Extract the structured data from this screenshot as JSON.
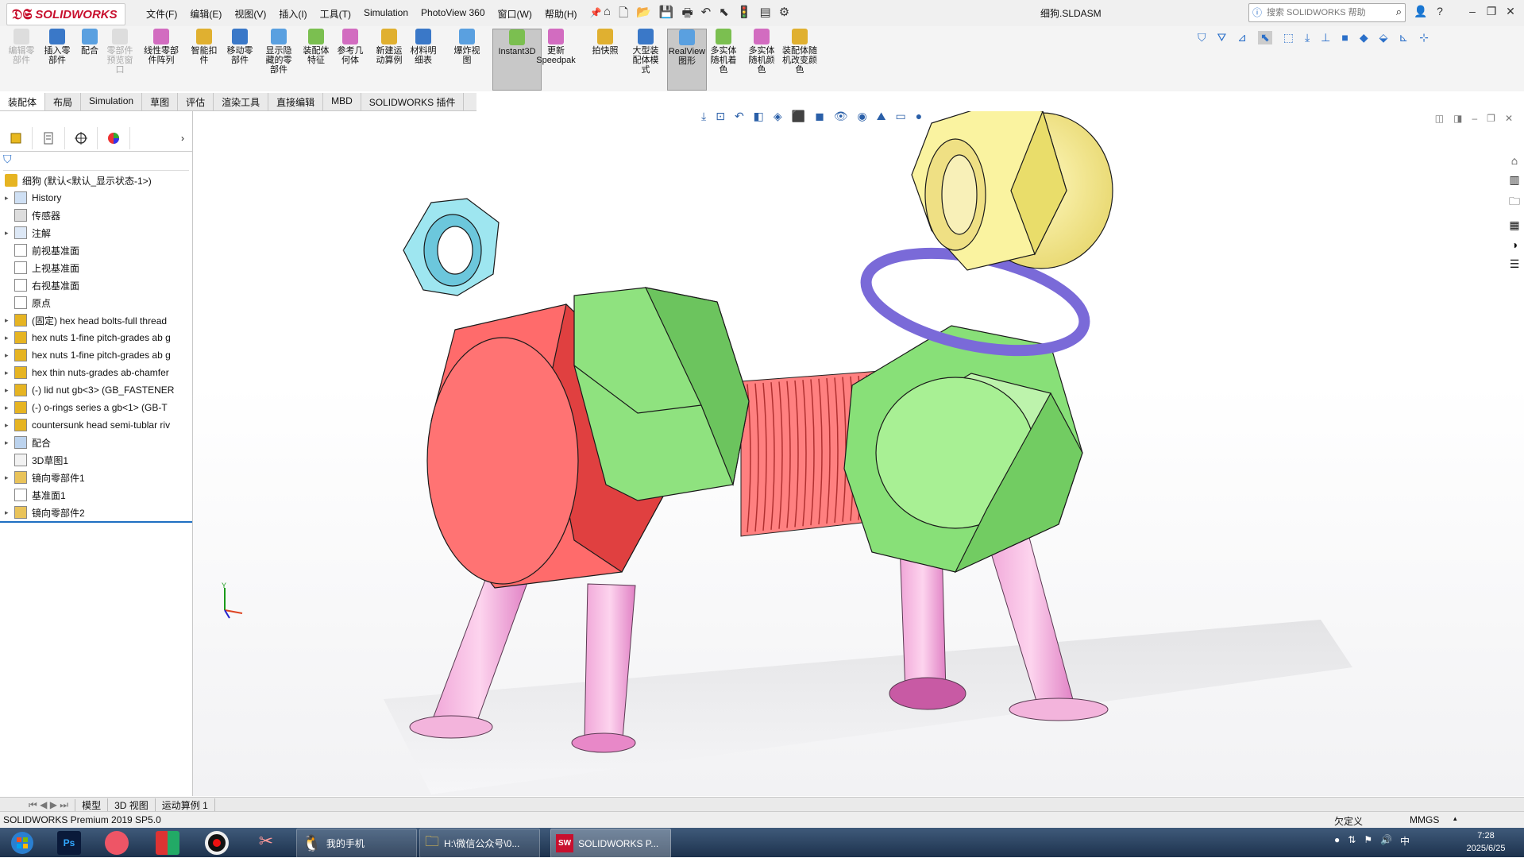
{
  "app": {
    "logo_text": "SOLIDWORKS",
    "document_title": "细狗.SLDASM",
    "menu": [
      "文件(F)",
      "编辑(E)",
      "视图(V)",
      "插入(I)",
      "工具(T)",
      "Simulation",
      "PhotoView 360",
      "窗口(W)",
      "帮助(H)"
    ],
    "search_placeholder": "搜索 SOLIDWORKS 帮助",
    "brand_color": "#c8102e"
  },
  "commands": [
    {
      "label": "编辑零部件",
      "disabled": true
    },
    {
      "label": "插入零部件",
      "disabled": false
    },
    {
      "label": "配合",
      "disabled": false
    },
    {
      "label": "零部件预览窗口",
      "disabled": true
    },
    {
      "label": "线性零部件阵列",
      "disabled": false
    },
    {
      "label": "智能扣件",
      "disabled": false
    },
    {
      "label": "移动零部件",
      "disabled": false
    },
    {
      "label": "显示隐藏的零部件",
      "disabled": false
    },
    {
      "label": "装配体特征",
      "disabled": false
    },
    {
      "label": "参考几何体",
      "disabled": false
    },
    {
      "label": "新建运动算例",
      "disabled": false
    },
    {
      "label": "材料明细表",
      "disabled": false
    },
    {
      "label": "爆炸视图",
      "disabled": false
    },
    {
      "label": "Instant3D",
      "disabled": false
    },
    {
      "label": "更新Speedpak",
      "disabled": false
    },
    {
      "label": "拍快照",
      "disabled": false
    },
    {
      "label": "大型装配体模式",
      "disabled": false
    },
    {
      "label": "RealView图形",
      "disabled": false
    },
    {
      "label": "多实体随机着色",
      "disabled": false
    },
    {
      "label": "多实体随机颜色",
      "disabled": false
    },
    {
      "label": "装配体随机改变颜色",
      "disabled": false
    }
  ],
  "tabs": [
    "装配体",
    "布局",
    "Simulation",
    "草图",
    "评估",
    "渲染工具",
    "直接编辑",
    "MBD",
    "SOLIDWORKS 插件"
  ],
  "tree": {
    "root": "细狗 (默认<默认_显示状态-1>)",
    "items": [
      {
        "label": "History",
        "expand": true
      },
      {
        "label": "传感器",
        "expand": false
      },
      {
        "label": "注解",
        "expand": true
      },
      {
        "label": "前视基准面",
        "expand": false
      },
      {
        "label": "上视基准面",
        "expand": false
      },
      {
        "label": "右视基准面",
        "expand": false
      },
      {
        "label": "原点",
        "expand": false
      },
      {
        "label": "(固定) hex head bolts-full thread",
        "expand": true
      },
      {
        "label": "hex nuts 1-fine pitch-grades ab g",
        "expand": true
      },
      {
        "label": "hex nuts 1-fine pitch-grades ab g",
        "expand": true
      },
      {
        "label": "hex thin nuts-grades ab-chamfer",
        "expand": true
      },
      {
        "label": "(-) lid nut gb<3> (GB_FASTENER",
        "expand": true
      },
      {
        "label": "(-) o-rings series a gb<1> (GB-T",
        "expand": true
      },
      {
        "label": "countersunk head semi-tublar riv",
        "expand": true
      },
      {
        "label": "配合",
        "expand": true
      },
      {
        "label": "3D草图1",
        "expand": false
      },
      {
        "label": "镜向零部件1",
        "expand": true
      },
      {
        "label": "基准面1",
        "expand": false
      },
      {
        "label": "镜向零部件2",
        "expand": true
      }
    ]
  },
  "bottom_tabs": [
    "模型",
    "3D 视图",
    "运动算例 1"
  ],
  "status": {
    "product": "SOLIDWORKS Premium 2019 SP5.0",
    "state": "欠定义",
    "units": "MMGS"
  },
  "taskbar": {
    "items": [
      "我的手机",
      "H:\\微信公众号\\0...",
      "SOLIDWORKS P..."
    ],
    "time": "7:28",
    "date": "2025/6/25"
  }
}
